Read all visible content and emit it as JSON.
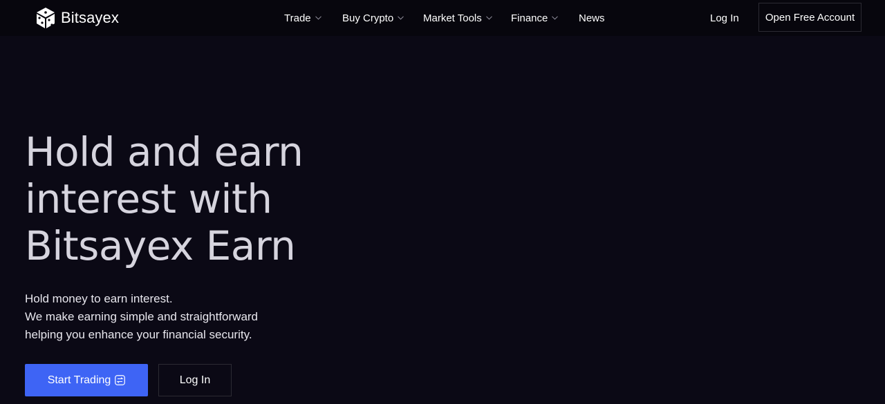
{
  "brand": {
    "name": "Bitsayex",
    "logo_icon": "cube-logo-icon"
  },
  "nav": {
    "items": [
      {
        "label": "Trade",
        "has_dropdown": true
      },
      {
        "label": "Buy Crypto",
        "has_dropdown": true
      },
      {
        "label": "Market Tools",
        "has_dropdown": true
      },
      {
        "label": "Finance",
        "has_dropdown": true
      },
      {
        "label": "News",
        "has_dropdown": false
      }
    ],
    "login_label": "Log In",
    "open_account_label": "Open Free Account"
  },
  "hero": {
    "title_lines": [
      "Hold and earn",
      "interest with",
      "Bitsayex Earn"
    ],
    "subtitle_lines": [
      "Hold money to earn interest.",
      "We make earning simple and straightforward",
      "helping you enhance your financial security."
    ],
    "primary_button": {
      "label": "Start Trading",
      "icon": "swap-icon"
    },
    "secondary_button": {
      "label": "Log In"
    }
  },
  "colors": {
    "background": "#0b0915",
    "header_background": "#07060d",
    "accent": "#3e64f5",
    "title_text": "#d6d4de",
    "border": "#2c2b33"
  }
}
